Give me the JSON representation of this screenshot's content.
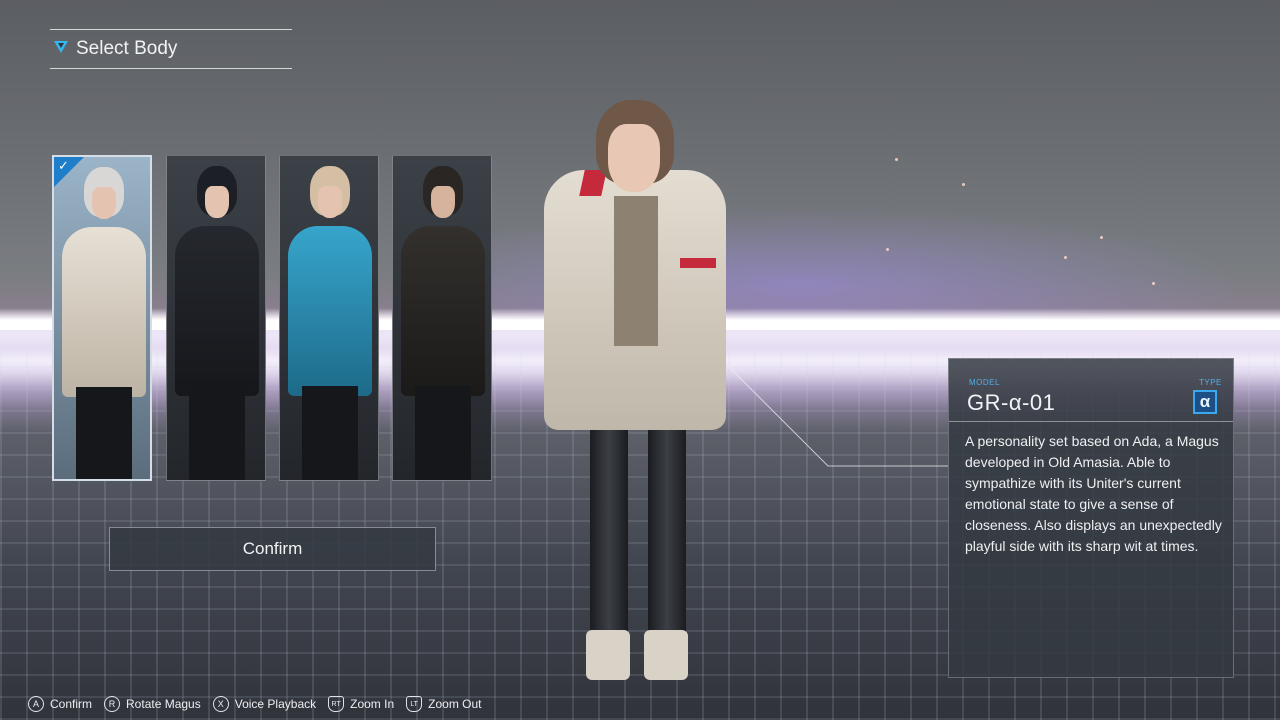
{
  "header": {
    "title": "Select Body"
  },
  "cards": [
    {
      "name": "card-ada",
      "selected": true,
      "hair": "#d9d7d6",
      "body": "#e2dbd0"
    },
    {
      "name": "card-2",
      "selected": false,
      "hair": "#1c1f26",
      "body": "#1f2227"
    },
    {
      "name": "card-3",
      "selected": false,
      "hair": "#d5bfa4",
      "body": "#2f93b9"
    },
    {
      "name": "card-4",
      "selected": false,
      "hair": "#2a2624",
      "body": "#2a2725"
    }
  ],
  "confirm_button": {
    "label": "Confirm"
  },
  "panel": {
    "model_label": "MODEL",
    "model_value": "GR-α-01",
    "type_label": "TYPE",
    "type_value": "α",
    "description": "A personality set based on Ada, a Magus developed in Old Amasia. Able to sympathize with its Uniter's current emotional state to give a sense of closeness. Also displays an unexpectedly playful side with its sharp wit at times."
  },
  "controls": [
    {
      "button": "A",
      "label": "Confirm",
      "icon": "a-button-icon"
    },
    {
      "button": "R",
      "label": "Rotate Magus",
      "icon": "right-stick-icon"
    },
    {
      "button": "X",
      "label": "Voice Playback",
      "icon": "x-button-icon"
    },
    {
      "button": "RT",
      "label": "Zoom In",
      "icon": "rt-trigger-icon"
    },
    {
      "button": "LT",
      "label": "Zoom Out",
      "icon": "lt-trigger-icon"
    }
  ],
  "colors": {
    "accent": "#34b6ee",
    "type_badge": "#1d4f86",
    "jacket_red": "#c42a3c"
  }
}
